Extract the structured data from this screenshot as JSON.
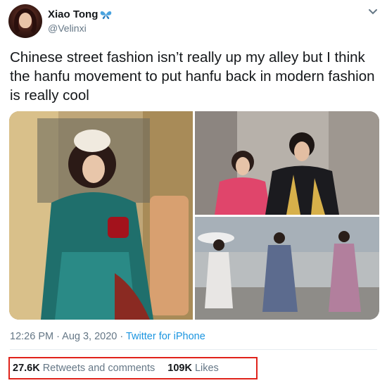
{
  "author": {
    "display_name": "Xiao Tong",
    "handle": "@Velinxi"
  },
  "tweet": {
    "text": "Chinese street fashion isn’t really up my alley but I think the hanfu movement to put hanfu back in modern fashion is really cool"
  },
  "meta": {
    "time": "12:26 PM · Aug 3, 2020 · ",
    "source": "Twitter for iPhone"
  },
  "stats": {
    "retweets_count": "27.6K",
    "retweets_label": "Retweets and comments",
    "likes_count": "109K",
    "likes_label": "Likes"
  },
  "icons": {
    "verified_decoration": "butterfly-icon",
    "menu": "chevron-down-icon"
  },
  "colors": {
    "link": "#1b95e0",
    "secondary_text": "#657786",
    "highlight_border": "#e0231b"
  }
}
